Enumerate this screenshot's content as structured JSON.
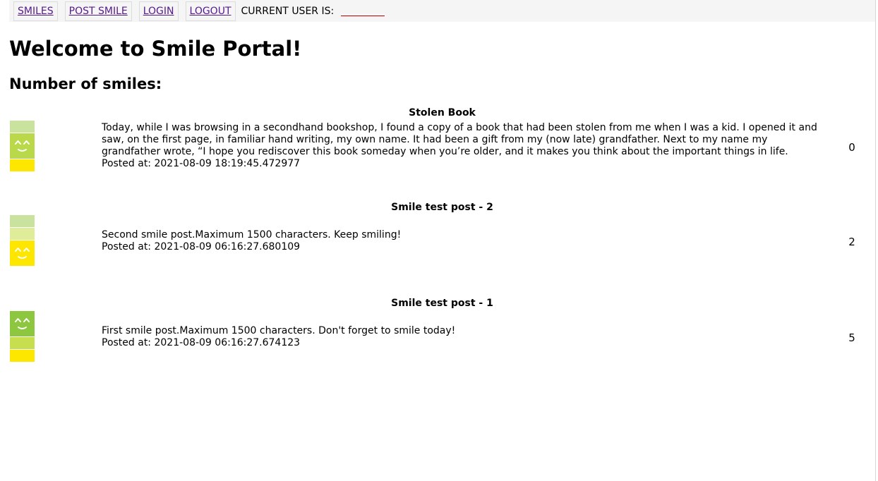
{
  "nav": {
    "links": [
      "SMILES",
      "POST SMILE",
      "LOGIN",
      "LOGOUT"
    ],
    "current_user_label": "CURRENT USER IS:",
    "current_user_value": ""
  },
  "heading": "Welcome to Smile Portal!",
  "subheading": "Number of smiles:",
  "posts": [
    {
      "title": "Stolen Book",
      "body": "Today, while I was browsing in a secondhand bookshop, I found a copy of a book that had been stolen from me when I was a kid. I opened it and saw, on the first page, in familiar hand writing, my own name. It had been a gift from my (now late) grandfather. Next to my name my grandfather wrote, “I hope you rediscover this book someday when you’re older, and it makes you think about the important things in life.",
      "posted": "Posted at: 2021-08-09 18:19:45.472977",
      "count": "0",
      "level": 2
    },
    {
      "title": "Smile test post - 2",
      "body": "Second smile post.Maximum 1500 characters. Keep smiling!",
      "posted": "Posted at: 2021-08-09 06:16:27.680109",
      "count": "2",
      "level": 1
    },
    {
      "title": "Smile test post - 1",
      "body": "First smile post.Maximum 1500 characters. Don't forget to smile today!",
      "posted": "Posted at: 2021-08-09 06:16:27.674123",
      "count": "5",
      "level": 3
    }
  ],
  "meter_colors": {
    "top": "#c9e39e",
    "mid": "#dfec9a",
    "face_low": "#fde600",
    "face_mid": "#b9d94a",
    "face_high": "#8dc63f",
    "bottom": "#fde600",
    "lime": "#c7df4e"
  }
}
